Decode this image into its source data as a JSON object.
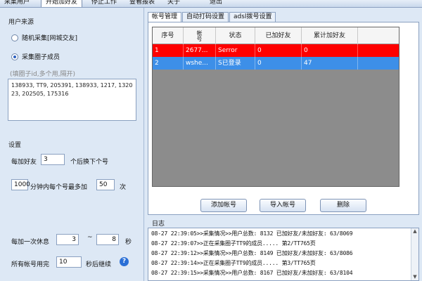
{
  "menu": {
    "items": [
      {
        "label": "采集用户"
      },
      {
        "label": "开始加好友"
      },
      {
        "label": "停止工作"
      },
      {
        "label": "查看报表"
      },
      {
        "label": "关于"
      },
      {
        "label": "退出"
      }
    ],
    "active_index": 1
  },
  "source": {
    "title": "用户来源",
    "option_random": "随机采集[网城交友]",
    "option_circle": "采集圈子成员",
    "selected": "option_circle",
    "hint": "(填圈子id,多个用,隔开)",
    "circle_ids": "138933, TT9, 205391, 138933, 1217, 132023, 202505, 175316"
  },
  "settings": {
    "title": "设置",
    "add_prefix": "每加好友",
    "add_value": "3",
    "add_suffix": "个后换下个号",
    "minutes_value": "1000",
    "minutes_mid": "分钟内每个号最多加",
    "minutes_max": "50",
    "minutes_suffix": "次",
    "rest_prefix": "每加一次休息",
    "rest_from": "3",
    "rest_dash": "~",
    "rest_to": "8",
    "rest_suffix": "秒",
    "done_prefix": "所有帐号用完",
    "done_value": "10",
    "done_suffix": "秒后继续",
    "help_icon": "?"
  },
  "tabs": [
    {
      "label": "帐号管理"
    },
    {
      "label": "自动打码设置"
    },
    {
      "label": "adsl拨号设置"
    }
  ],
  "grid": {
    "headers": [
      "序号",
      "帐号",
      "状态",
      "已加好友",
      "累计加好友"
    ],
    "rows": [
      {
        "cells": [
          "1",
          "2677...",
          "Serror",
          "0",
          "0"
        ],
        "color": "#ff0000"
      },
      {
        "cells": [
          "2",
          "wshe...",
          "S已登录",
          "0",
          "47"
        ],
        "color": "#3d8fe8"
      }
    ]
  },
  "buttons": {
    "add": "添加帐号",
    "import": "导入帐号",
    "delete": "删除"
  },
  "log": {
    "title": "日志",
    "lines": [
      "08-27 22:39:05>>采集情况>>用户总数: 8132 已加好友/未加好友: 63/8069",
      "08-27 22:39:07>>正在采集圈子TT9的成员.....  第2/TT765页",
      "08-27 22:39:12>>采集情况>>用户总数: 8149 已加好友/未加好友: 63/8086",
      "08-27 22:39:14>>正在采集圈子TT9的成员.....  第3/TT765页",
      "08-27 22:39:15>>采集情况>>用户总数: 8167 已加好友/未加好友: 63/8104"
    ]
  }
}
